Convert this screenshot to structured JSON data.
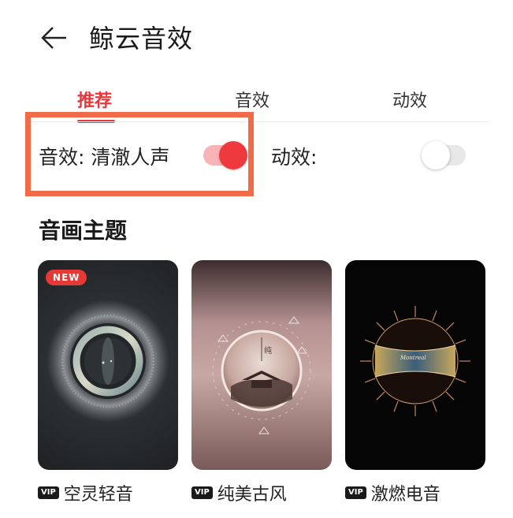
{
  "header": {
    "title": "鲸云音效",
    "back_icon": "arrow-left-icon"
  },
  "tabs": [
    {
      "label": "推荐",
      "active": true
    },
    {
      "label": "音效",
      "active": false
    },
    {
      "label": "动效",
      "active": false
    }
  ],
  "settings": {
    "sound_label": "音效: 清澈人声",
    "sound_enabled": true,
    "anim_label": "动效:",
    "anim_enabled": false
  },
  "section": {
    "title": "音画主题"
  },
  "themes": [
    {
      "name": "空灵轻音",
      "badge": "NEW",
      "vip_label": "VIP"
    },
    {
      "name": "纯美古风",
      "badge": "",
      "vip_label": "VIP"
    },
    {
      "name": "激燃电音",
      "badge": "",
      "vip_label": "VIP"
    }
  ],
  "colors": {
    "accent": "#e8373a",
    "highlight": "#f26b49"
  }
}
